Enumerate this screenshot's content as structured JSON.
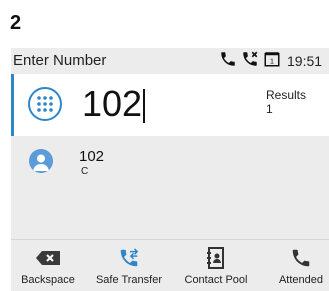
{
  "step_number": "2",
  "status_bar": {
    "title": "Enter Number",
    "time": "19:51",
    "icons": [
      "phone-icon",
      "missed-call-icon",
      "calendar-1-icon"
    ]
  },
  "input": {
    "value": "102",
    "icon": "dialpad-icon",
    "results_label": "Results",
    "results_count": "1"
  },
  "results": [
    {
      "name": "102",
      "sub": "C",
      "icon": "contact-avatar-icon"
    }
  ],
  "softkeys": [
    {
      "label": "Backspace",
      "icon": "backspace-icon"
    },
    {
      "label": "Safe Transfer",
      "icon": "transfer-icon"
    },
    {
      "label": "Contact Pool",
      "icon": "contact-book-icon"
    },
    {
      "label": "Attended",
      "icon": "phone-icon"
    }
  ],
  "colors": {
    "accent": "#2e86c9",
    "avatar": "#5a9bd8",
    "screen_bg": "#ececec",
    "highlight_bg": "#ffffff"
  }
}
